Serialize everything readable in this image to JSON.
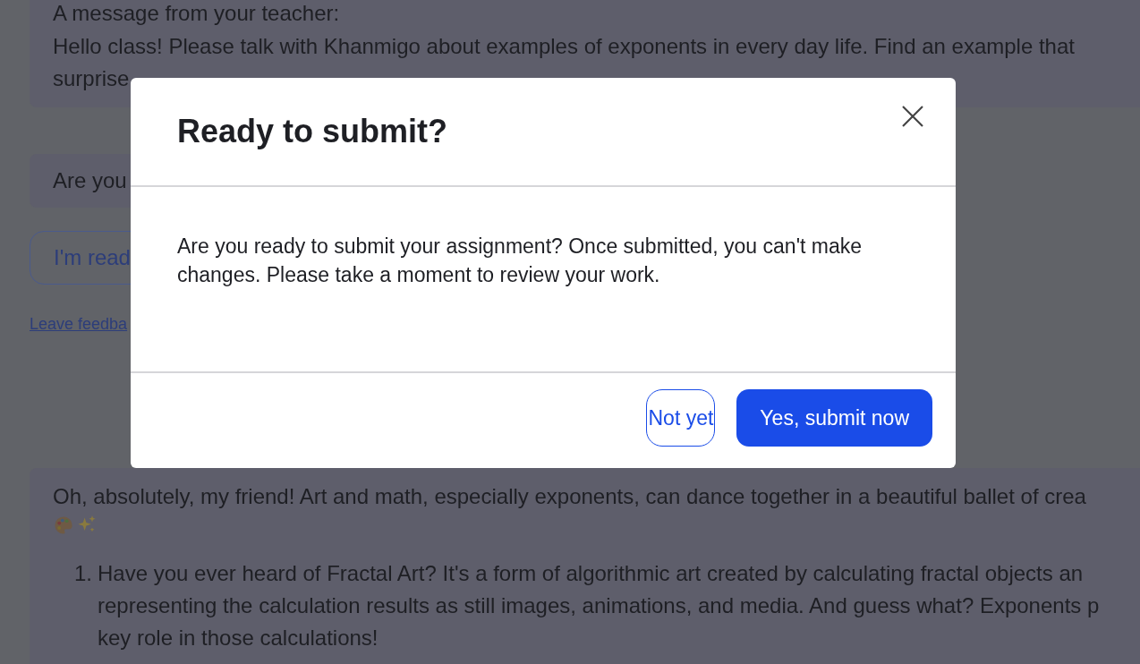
{
  "background": {
    "teacher_message": {
      "heading": "A message from your teacher:",
      "lines": [
        "Hello class! Please talk with Khanmigo about examples of exponents in every day life. Find an example that",
        "surprise"
      ]
    },
    "prompt": {
      "text": "Are you"
    },
    "ready_button": {
      "label": "I'm read"
    },
    "feedback_link": {
      "label": "Leave feedba"
    },
    "reply": {
      "lines": [
        "Oh, absolutely, my friend! Art and math, especially exponents, can dance together in a beautiful ballet of crea"
      ],
      "list_items": [
        {
          "number": "1.",
          "lines": [
            "Have you ever heard of Fractal Art? It's a form of algorithmic art created by calculating fractal objects an",
            "representing the calculation results as still images, animations, and media. And guess what? Exponents p",
            "key role in those calculations!"
          ]
        }
      ]
    }
  },
  "dialog": {
    "title": "Ready to submit?",
    "body": "Are you ready to submit your assignment? Once submitted, you can't make changes. Please take a moment to review your work.",
    "buttons": [
      {
        "label": "Not yet",
        "kind": "secondary"
      },
      {
        "label": "Yes, submit now",
        "kind": "primary"
      }
    ]
  }
}
